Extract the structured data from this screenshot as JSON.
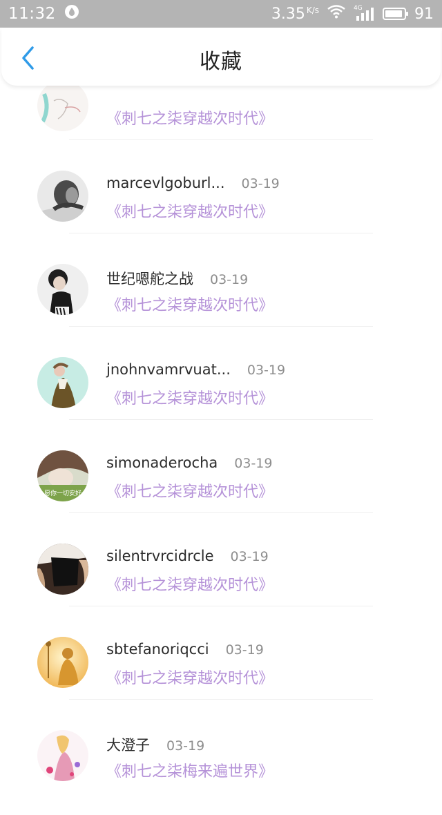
{
  "status_bar": {
    "time": "11:32",
    "speed": "3.35",
    "speed_unit": "K/s",
    "network": "4G",
    "battery": "91",
    "battery_level": 0.91
  },
  "header": {
    "title": "收藏",
    "back_icon": "chevron-left-icon"
  },
  "items": [
    {
      "name": "",
      "date": "",
      "book": "《刺七之柒穿越次时代》"
    },
    {
      "name": "marcevlgoburl...",
      "date": "03-19",
      "book": "《刺七之柒穿越次时代》"
    },
    {
      "name": "世纪嗯舵之战",
      "date": "03-19",
      "book": "《刺七之柒穿越次时代》"
    },
    {
      "name": "jnohnvamrvuat...",
      "date": "03-19",
      "book": "《刺七之柒穿越次时代》"
    },
    {
      "name": "simonaderocha",
      "date": "03-19",
      "book": "《刺七之柒穿越次时代》"
    },
    {
      "name": "silentrvrcidrcle",
      "date": "03-19",
      "book": "《刺七之柒穿越次时代》"
    },
    {
      "name": "sbtefanoriqcci",
      "date": "03-19",
      "book": "《刺七之柒穿越次时代》"
    },
    {
      "name": "大澄子",
      "date": "03-19",
      "book": "《刺七之柒梅来遍世界》"
    }
  ],
  "avatar_texts": {
    "simonaderocha": "愿你一切安好"
  },
  "colors": {
    "accent": "#2f9be8",
    "book_title": "#b592d8",
    "status_bar": "#b4b4b4"
  }
}
